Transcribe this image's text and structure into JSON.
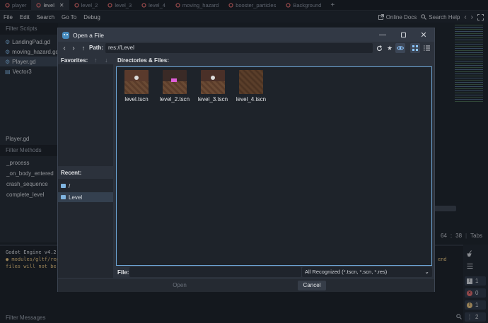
{
  "tabs": [
    {
      "label": "player",
      "color": "#e26a6a",
      "active": false
    },
    {
      "label": "level",
      "color": "#e26a6a",
      "active": true
    },
    {
      "label": "level_2",
      "color": "#e26a6a",
      "active": false
    },
    {
      "label": "level_3",
      "color": "#e26a6a",
      "active": false
    },
    {
      "label": "level_4",
      "color": "#e26a6a",
      "active": false
    },
    {
      "label": "moving_hazard",
      "color": "#e26a6a",
      "active": false
    },
    {
      "label": "booster_particles",
      "color": "#e26a6a",
      "active": false
    },
    {
      "label": "Background",
      "color": "#e26a6a",
      "active": false
    }
  ],
  "menu": {
    "file": "File",
    "edit": "Edit",
    "search": "Search",
    "goto": "Go To",
    "debug": "Debug",
    "online_docs": "Online Docs",
    "search_help": "Search Help"
  },
  "scripts_panel": {
    "filter_placeholder": "Filter Scripts",
    "scripts": [
      "LandingPad.gd",
      "moving_hazard.gd",
      "Player.gd",
      "Vector3"
    ],
    "selected_script": "Player.gd",
    "current_script": "Player.gd",
    "filter_methods_placeholder": "Filter Methods",
    "methods": [
      "_process",
      "_on_body_entered",
      "crash_sequence",
      "complete_level"
    ]
  },
  "dialog": {
    "title": "Open a File",
    "path_label": "Path:",
    "path_value": "res://Level",
    "favorites_label": "Favorites:",
    "recent_label": "Recent:",
    "recent_items": [
      "/",
      "Level"
    ],
    "files_label": "Directories & Files:",
    "files": [
      "level.tscn",
      "level_2.tscn",
      "level_3.tscn",
      "level_4.tscn"
    ],
    "file_label": "File:",
    "file_value": "",
    "filter_value": "All Recognized (*.tscn, *.scn, *.res)",
    "open_button": "Open",
    "cancel_button": "Cancel"
  },
  "editor_status": {
    "line": "64",
    "sep": ":",
    "col": "38",
    "indent": "Tabs"
  },
  "output": {
    "line1": "Godot Engine v4.2.",
    "line2": "● modules/gltf/reg",
    "line3": "files will not be",
    "right_text": "end",
    "filter_placeholder": "Filter Messages",
    "counts": {
      "errors": "1",
      "warnings": "0",
      "info": "1",
      "messages": "2"
    }
  },
  "colors": {
    "accent": "#6ea6d6",
    "warning": "#e5c07b",
    "error": "#e26a6a"
  }
}
